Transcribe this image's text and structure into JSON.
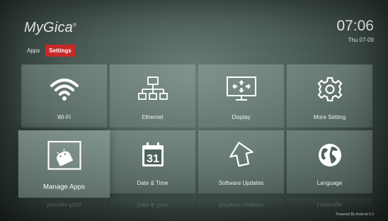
{
  "header": {
    "logo_text": "MyGica",
    "logo_reg": "®",
    "time": "07:06",
    "date": "Thu 07-09"
  },
  "tabs": [
    {
      "label": "Apps",
      "active": false
    },
    {
      "label": "Settings",
      "active": true
    }
  ],
  "tiles": [
    {
      "label": "Wi-Fi",
      "icon": "wifi-icon"
    },
    {
      "label": "Ethernet",
      "icon": "ethernet-icon"
    },
    {
      "label": "Display",
      "icon": "display-icon"
    },
    {
      "label": "More Setting",
      "icon": "gear-icon"
    },
    {
      "label": "Manage Apps",
      "icon": "android-icon",
      "selected": true
    },
    {
      "label": "Date & Time",
      "icon": "calendar-icon",
      "calendar_day": "31"
    },
    {
      "label": "Software Updates",
      "icon": "update-arrow-icon"
    },
    {
      "label": "Language",
      "icon": "globe-icon"
    }
  ],
  "footer": {
    "powered_by": "Powered By Android 5.0"
  },
  "colors": {
    "active_tab": "#c62a2a",
    "tile_bg": "#8fa39e",
    "text": "#eef2f0"
  }
}
